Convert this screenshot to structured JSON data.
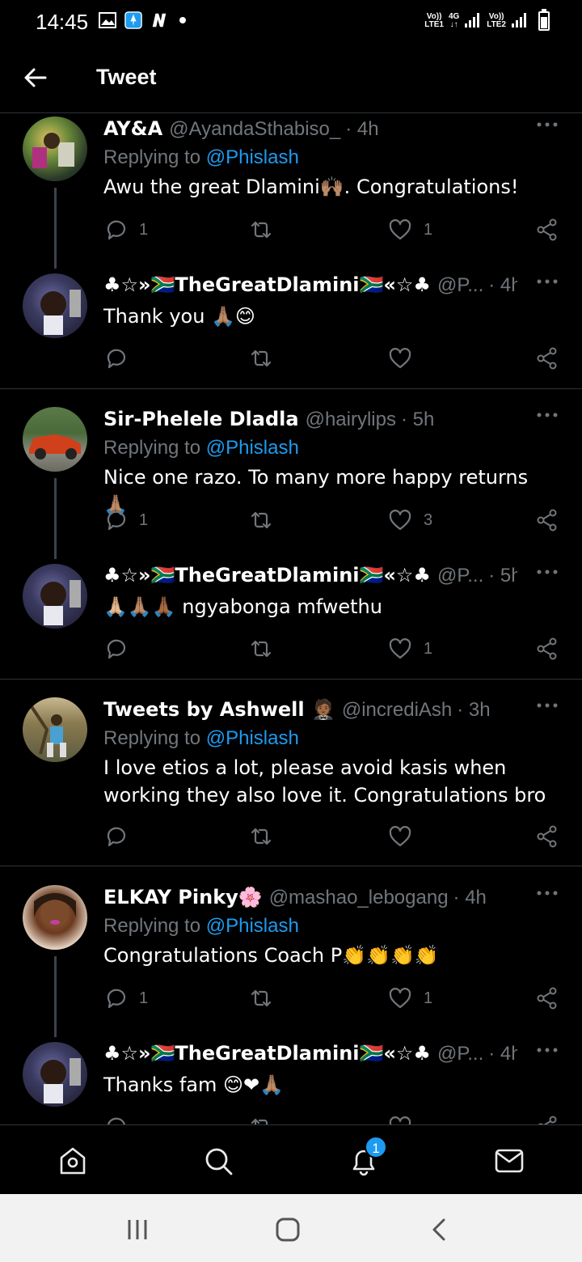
{
  "status_bar": {
    "time": "14:45",
    "sim1_label_top": "Vo))",
    "sim1_label_bottom": "LTE1",
    "network_type": "4G",
    "sim2_label_top": "Vo))",
    "sim2_label_bottom": "LTE2",
    "icons": [
      "gallery-icon",
      "app-notification-icon",
      "n-app-icon",
      "dot",
      "signal-icon",
      "battery-icon"
    ]
  },
  "header": {
    "title": "Tweet"
  },
  "tweets": [
    {
      "name": "AY&A",
      "handle": "@AyandaSthabiso_",
      "time": "· 4h",
      "replying_prefix": "Replying to",
      "replying_to": "@Phislash",
      "text": "Awu the great Dlamini🙌🏽. Congratulations!",
      "replies": "1",
      "retweets": "",
      "likes": "1"
    },
    {
      "name": "♣☆»🇿🇦TheGreatDlamini🇿🇦«☆♣",
      "handle": "@P...",
      "time": "· 4h",
      "text": "Thank you 🙏🏽😊",
      "replies": "",
      "retweets": "",
      "likes": ""
    },
    {
      "name": "Sir-Phelele Dladla",
      "handle": "@hairylips",
      "time": "· 5h",
      "replying_prefix": "Replying to",
      "replying_to": "@Phislash",
      "text": "Nice one razo. To many more happy returns 🙏🏽",
      "replies": "1",
      "retweets": "",
      "likes": "3"
    },
    {
      "name": "♣☆»🇿🇦TheGreatDlamini🇿🇦«☆♣",
      "handle": "@P...",
      "time": "· 5h",
      "text": "🙏🏼🙏🏽🙏🏾 ngyabonga mfwethu",
      "replies": "",
      "retweets": "",
      "likes": "1"
    },
    {
      "name": "Tweets by Ashwell 🤵🏾",
      "handle": "@incrediAsh",
      "time": "· 3h",
      "replying_prefix": "Replying to",
      "replying_to": "@Phislash",
      "text": "I love etios a lot, please avoid kasis when working they also love it. Congratulations bro",
      "replies": "",
      "retweets": "",
      "likes": ""
    },
    {
      "name": "ELKAY Pinky🌸",
      "handle": "@mashao_lebogang",
      "time": "· 4h",
      "replying_prefix": "Replying to",
      "replying_to": "@Phislash",
      "text": "Congratulations Coach P👏👏👏👏",
      "replies": "1",
      "retweets": "",
      "likes": "1"
    },
    {
      "name": "♣☆»🇿🇦TheGreatDlamini🇿🇦«☆♣",
      "handle": "@P...",
      "time": "· 4h",
      "text": "Thanks fam 😊❤🙏🏽",
      "replies": "",
      "retweets": "",
      "likes": ""
    }
  ],
  "bottom_nav": {
    "items": [
      "home-icon",
      "search-icon",
      "notifications-icon",
      "messages-icon"
    ],
    "notification_badge": "1"
  },
  "system_nav": {
    "items": [
      "recent-apps-icon",
      "home-button-icon",
      "back-button-icon"
    ]
  },
  "colors": {
    "background": "#000000",
    "accent": "#1d9bf0",
    "muted": "#71767b",
    "divider": "#2f3336"
  }
}
